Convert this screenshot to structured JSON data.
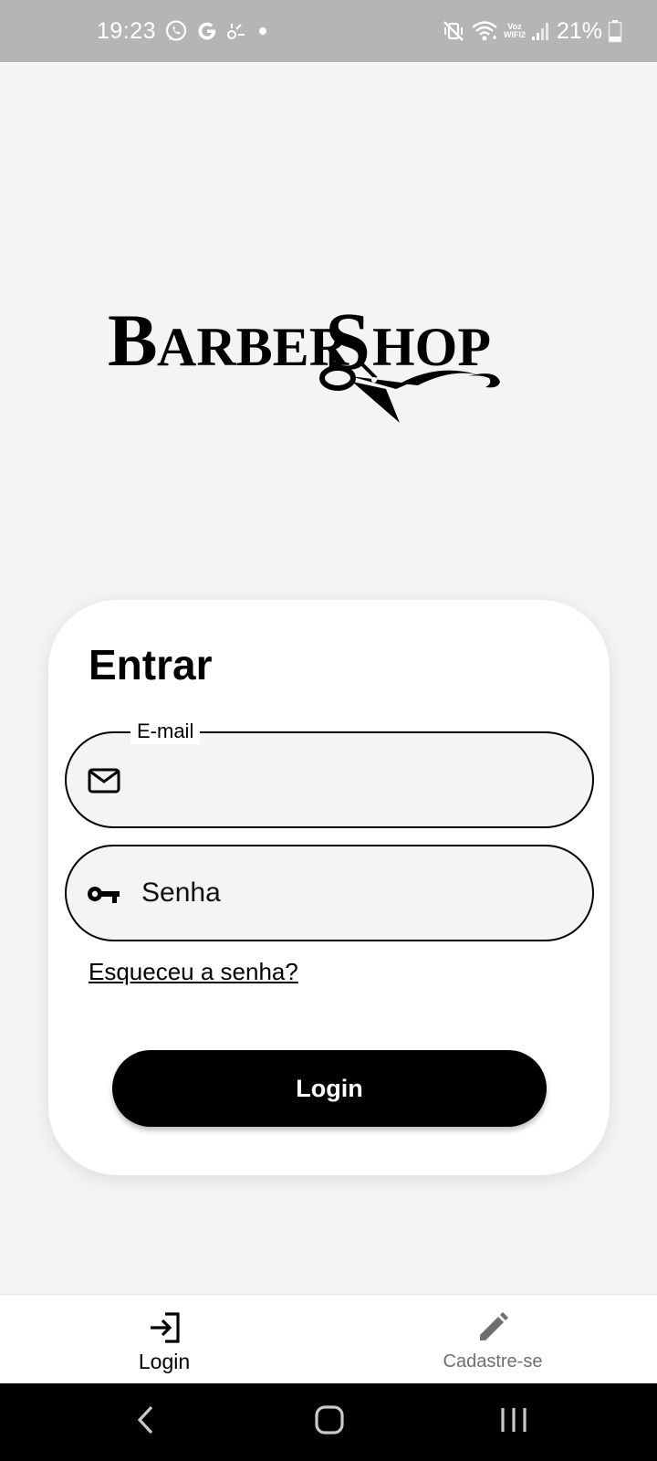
{
  "status_bar": {
    "time": "19:23",
    "battery": "21%",
    "network_label_top": "Voz",
    "network_label_bottom": "WIFI2",
    "left_icons": [
      "whatsapp-icon",
      "google-icon",
      "spark-icon",
      "dot-icon"
    ],
    "right_icons": [
      "mute-vibrate-icon",
      "wifi-icon",
      "voz-wifi-label",
      "signal-icon",
      "battery-icon"
    ]
  },
  "logo": {
    "text_part1": "BARBER",
    "text_part2": "SHOP",
    "icon": "scissors-icon"
  },
  "login_card": {
    "title": "Entrar",
    "email_field": {
      "label": "E-mail",
      "value": "",
      "icon": "mail-icon"
    },
    "password_field": {
      "placeholder": "Senha",
      "value": "",
      "icon": "key-icon"
    },
    "forgot_password_link": "Esqueceu a senha?",
    "login_button": "Login"
  },
  "bottom_nav": {
    "items": [
      {
        "label": "Login",
        "icon": "login-arrow-icon",
        "active": true
      },
      {
        "label": "Cadastre-se",
        "icon": "pencil-icon",
        "active": false
      }
    ]
  },
  "system_nav": {
    "buttons": [
      "back-icon",
      "home-icon",
      "recents-icon"
    ]
  },
  "colors": {
    "background": "#f4f4f4",
    "status_bar": "#b5b5b5",
    "card": "#ffffff",
    "primary": "#000000",
    "inactive_nav": "#6f6f6f"
  }
}
